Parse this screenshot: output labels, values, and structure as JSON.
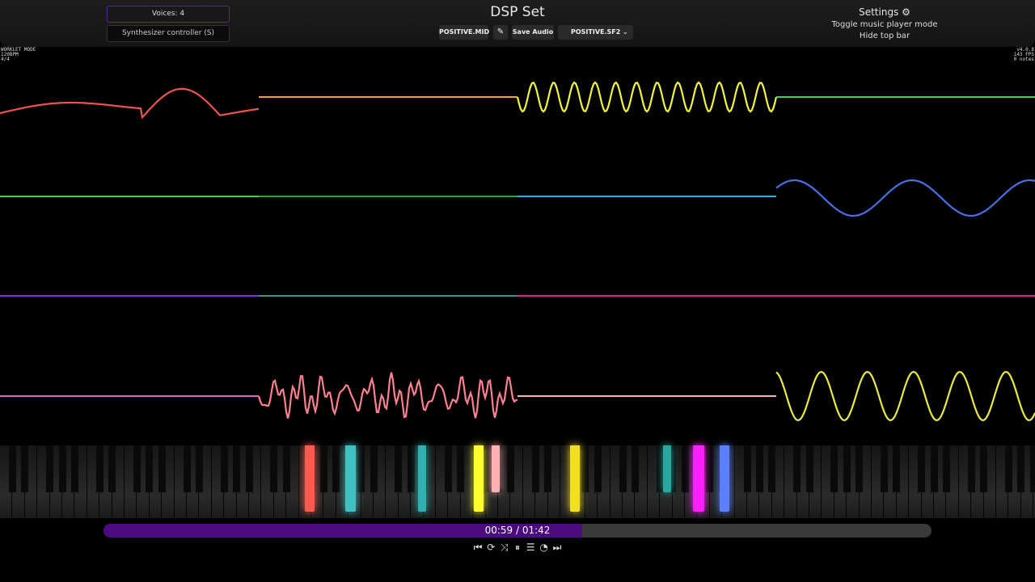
{
  "app": {
    "title": "DSP Set",
    "voices_label": "Voices: 4",
    "synth_controller_label": "Synthesizer controller (S)"
  },
  "toolbar": {
    "midi_file": "POSITIVE.MID",
    "save_audio": "Save Audio",
    "soundfont": "POSITIVE.SF2",
    "dropdown_glyph": "⌄",
    "edit_icon_glyph": "✎"
  },
  "settings": {
    "label": "Settings",
    "gear_glyph": "⚙",
    "toggle_mode": "Toggle music player mode",
    "hide_top_bar": "Hide top bar"
  },
  "status_left": [
    "WORKLET MODE",
    "120BPM",
    "4/4"
  ],
  "status_right": [
    "v4.0.8",
    "143 FPS",
    "0 notes"
  ],
  "channel_colors": [
    "#ef5350",
    "#ffa040",
    "#f4f440",
    "#40d040",
    "#40d040",
    "#30a830",
    "#3aa8e8",
    "#4a6ee8",
    "#8a2be2",
    "#2a9a8a",
    "#e0208a",
    "#e0208a",
    "#e060d0",
    "#ff8090",
    "#ffb0b8",
    "#eaea40"
  ],
  "piano": {
    "highlight_colors": [
      "#ff5a4e",
      "#40c0c0",
      "#30b0b0",
      "#ffff30",
      "#ffb0b0",
      "#f2e020",
      "#2aa8a0",
      "#ff20ff",
      "#5a80ff"
    ]
  },
  "player": {
    "time_display": "00:59 / 01:42",
    "progress": 0.5781,
    "controls": [
      "skip-previous-icon",
      "loop-icon",
      "shuffle-icon",
      "pause-icon",
      "playlist-icon",
      "speed-icon",
      "skip-next-icon"
    ],
    "control_glyphs": [
      "⏮",
      "⟳",
      "⤨",
      "⏸",
      "☰",
      "◔",
      "⏭"
    ]
  }
}
